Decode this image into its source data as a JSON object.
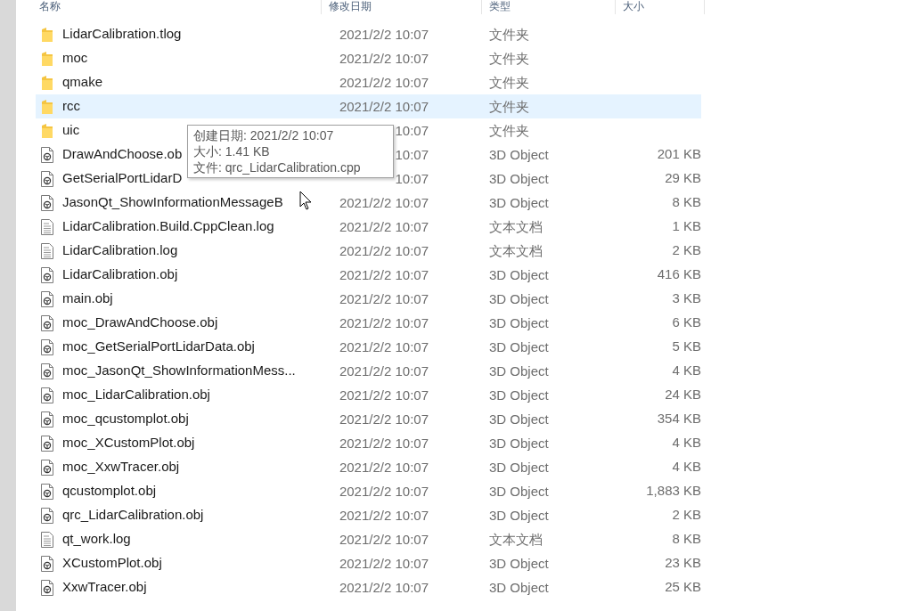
{
  "columns": [
    "名称",
    "修改日期",
    "类型",
    "大小"
  ],
  "rows": [
    {
      "kind": "folder",
      "name": "LidarCalibration.tlog",
      "date": "2021/2/2 10:07",
      "type": "文件夹",
      "selected": false
    },
    {
      "kind": "folder",
      "name": "moc",
      "date": "2021/2/2 10:07",
      "type": "文件夹",
      "selected": false
    },
    {
      "kind": "folder",
      "name": "qmake",
      "date": "2021/2/2 10:07",
      "type": "文件夹",
      "selected": false
    },
    {
      "kind": "folder",
      "name": "rcc",
      "date": "2021/2/2 10:07",
      "type": "文件夹",
      "selected": true
    },
    {
      "kind": "folder",
      "name": "uic",
      "date": "10:07",
      "type": "文件夹",
      "selected": false
    },
    {
      "kind": "object",
      "name": "DrawAndChoose.ob",
      "date": "10:07",
      "type": "3D Object",
      "size": "201 KB",
      "selected": false
    },
    {
      "kind": "object",
      "name": "GetSerialPortLidarD",
      "date": "10:07",
      "type": "3D Object",
      "size": "29 KB",
      "selected": false
    },
    {
      "kind": "object",
      "name": "JasonQt_ShowInformationMessageB",
      "date": "2021/2/2 10:07",
      "type": "3D Object",
      "size": "8 KB",
      "selected": false
    },
    {
      "kind": "text",
      "name": "LidarCalibration.Build.CppClean.log",
      "date": "2021/2/2 10:07",
      "type": "文本文档",
      "size": "1 KB",
      "selected": false
    },
    {
      "kind": "text",
      "name": "LidarCalibration.log",
      "date": "2021/2/2 10:07",
      "type": "文本文档",
      "size": "2 KB",
      "selected": false
    },
    {
      "kind": "object",
      "name": "LidarCalibration.obj",
      "date": "2021/2/2 10:07",
      "type": "3D Object",
      "size": "416 KB",
      "selected": false
    },
    {
      "kind": "object",
      "name": "main.obj",
      "date": "2021/2/2 10:07",
      "type": "3D Object",
      "size": "3 KB",
      "selected": false
    },
    {
      "kind": "object",
      "name": "moc_DrawAndChoose.obj",
      "date": "2021/2/2 10:07",
      "type": "3D Object",
      "size": "6 KB",
      "selected": false
    },
    {
      "kind": "object",
      "name": "moc_GetSerialPortLidarData.obj",
      "date": "2021/2/2 10:07",
      "type": "3D Object",
      "size": "5 KB",
      "selected": false
    },
    {
      "kind": "object",
      "name": "moc_JasonQt_ShowInformationMess...",
      "date": "2021/2/2 10:07",
      "type": "3D Object",
      "size": "4 KB",
      "selected": false
    },
    {
      "kind": "object",
      "name": "moc_LidarCalibration.obj",
      "date": "2021/2/2 10:07",
      "type": "3D Object",
      "size": "24 KB",
      "selected": false
    },
    {
      "kind": "object",
      "name": "moc_qcustomplot.obj",
      "date": "2021/2/2 10:07",
      "type": "3D Object",
      "size": "354 KB",
      "selected": false
    },
    {
      "kind": "object",
      "name": "moc_XCustomPlot.obj",
      "date": "2021/2/2 10:07",
      "type": "3D Object",
      "size": "4 KB",
      "selected": false
    },
    {
      "kind": "object",
      "name": "moc_XxwTracer.obj",
      "date": "2021/2/2 10:07",
      "type": "3D Object",
      "size": "4 KB",
      "selected": false
    },
    {
      "kind": "object",
      "name": "qcustomplot.obj",
      "date": "2021/2/2 10:07",
      "type": "3D Object",
      "size": "1,883 KB",
      "selected": false
    },
    {
      "kind": "object",
      "name": "qrc_LidarCalibration.obj",
      "date": "2021/2/2 10:07",
      "type": "3D Object",
      "size": "2 KB",
      "selected": false
    },
    {
      "kind": "text",
      "name": "qt_work.log",
      "date": "2021/2/2 10:07",
      "type": "文本文档",
      "size": "8 KB",
      "selected": false
    },
    {
      "kind": "object",
      "name": "XCustomPlot.obj",
      "date": "2021/2/2 10:07",
      "type": "3D Object",
      "size": "23 KB",
      "selected": false
    },
    {
      "kind": "object",
      "name": "XxwTracer.obj",
      "date": "2021/2/2 10:07",
      "type": "3D Object",
      "size": "25 KB",
      "selected": false
    }
  ],
  "tooltip": [
    "创建日期: 2021/2/2 10:07",
    "大小: 1.41 KB",
    "文件: qrc_LidarCalibration.cpp"
  ]
}
